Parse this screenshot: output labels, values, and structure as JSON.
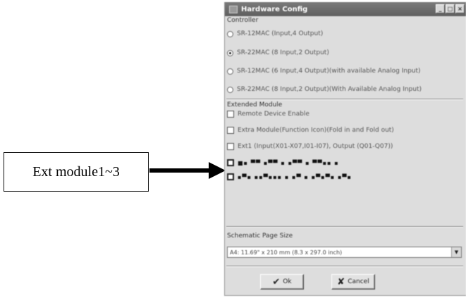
{
  "callout": {
    "label": "Ext module1~3"
  },
  "window": {
    "title": "Hardware Config",
    "controls": [
      "_",
      "□",
      "×"
    ]
  },
  "controller": {
    "label": "Controller",
    "options": [
      {
        "label": "SR-12MAC (Input,4 Output)",
        "checked": false
      },
      {
        "label": "SR-22MAC (8 Input,2 Output)",
        "checked": true
      },
      {
        "label": "SR-12MAC (6 Input,4 Output)(with available Analog Input)",
        "checked": false
      },
      {
        "label": "SR-22MAC (8 Input,2 Output)(With Available Analog Input)",
        "checked": false
      }
    ]
  },
  "extended": {
    "label": "Extended Module",
    "items": [
      {
        "label": "Remote Device Enable"
      },
      {
        "label": "Extra Module(Function Icon)(Fold in and Fold out)"
      },
      {
        "label": "Ext1 (Input(X01-X07,I01-I07), Output (Q01-Q07))"
      },
      {
        "label": "■▪ ▀▀ ▪▀▀ ▪ ▪▀▀ ▪ ▀▀▪▪ ▪"
      },
      {
        "label": "▪▀▪ ▪▪▀▪▪▪ ▪ ▪▀ ▪ ▪▀▪▀▪ ▪▀▪"
      }
    ]
  },
  "schematic": {
    "label": "Schematic Page Size",
    "value": "A4: 11.69\" x 210 mm (8.3 x 297.0 inch)"
  },
  "buttons": {
    "ok": "Ok",
    "cancel": "Cancel"
  }
}
